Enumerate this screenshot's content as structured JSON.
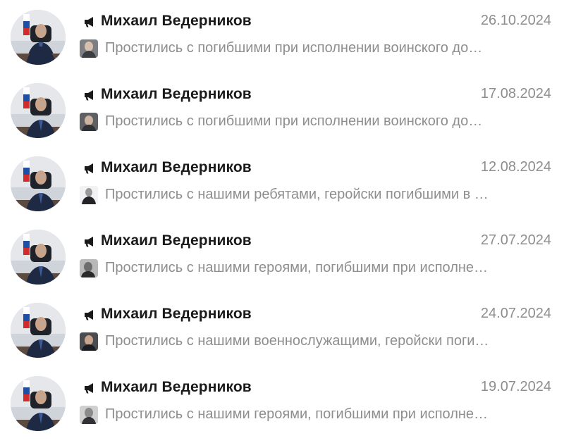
{
  "chats": [
    {
      "name": "Михаил Ведерников",
      "date": "26.10.2024",
      "preview": "Простились с погибшими при исполнении воинского до…",
      "avatar_icon": "channel-avatar-photo",
      "channel_icon": "megaphone-icon",
      "thumb_icon": "person-photo-thumbnail"
    },
    {
      "name": "Михаил Ведерников",
      "date": "17.08.2024",
      "preview": "Простились с погибшими при исполнении воинского до…",
      "avatar_icon": "channel-avatar-photo",
      "channel_icon": "megaphone-icon",
      "thumb_icon": "person-photo-thumbnail"
    },
    {
      "name": "Михаил Ведерников",
      "date": "12.08.2024",
      "preview": "Простились с нашими ребятами, геройски погибшими в …",
      "avatar_icon": "channel-avatar-photo",
      "channel_icon": "megaphone-icon",
      "thumb_icon": "person-photo-thumbnail"
    },
    {
      "name": "Михаил Ведерников",
      "date": "27.07.2024",
      "preview": "Простились с нашими героями, погибшими при исполне…",
      "avatar_icon": "channel-avatar-photo",
      "channel_icon": "megaphone-icon",
      "thumb_icon": "person-photo-thumbnail"
    },
    {
      "name": "Михаил Ведерников",
      "date": "24.07.2024",
      "preview": "Простились с нашими военнослужащими, геройски поги…",
      "avatar_icon": "channel-avatar-photo",
      "channel_icon": "megaphone-icon",
      "thumb_icon": "person-photo-thumbnail"
    },
    {
      "name": "Михаил Ведерников",
      "date": "19.07.2024",
      "preview": "Простились с нашими героями, погибшими при исполне…",
      "avatar_icon": "channel-avatar-photo",
      "channel_icon": "megaphone-icon",
      "thumb_icon": "person-photo-thumbnail"
    }
  ],
  "colors": {
    "name_text": "#1a1a1a",
    "secondary_text": "#8e8e8e",
    "background": "#ffffff",
    "flag_white": "#ffffff",
    "flag_blue": "#1c4fa8",
    "flag_red": "#d42a2a"
  }
}
